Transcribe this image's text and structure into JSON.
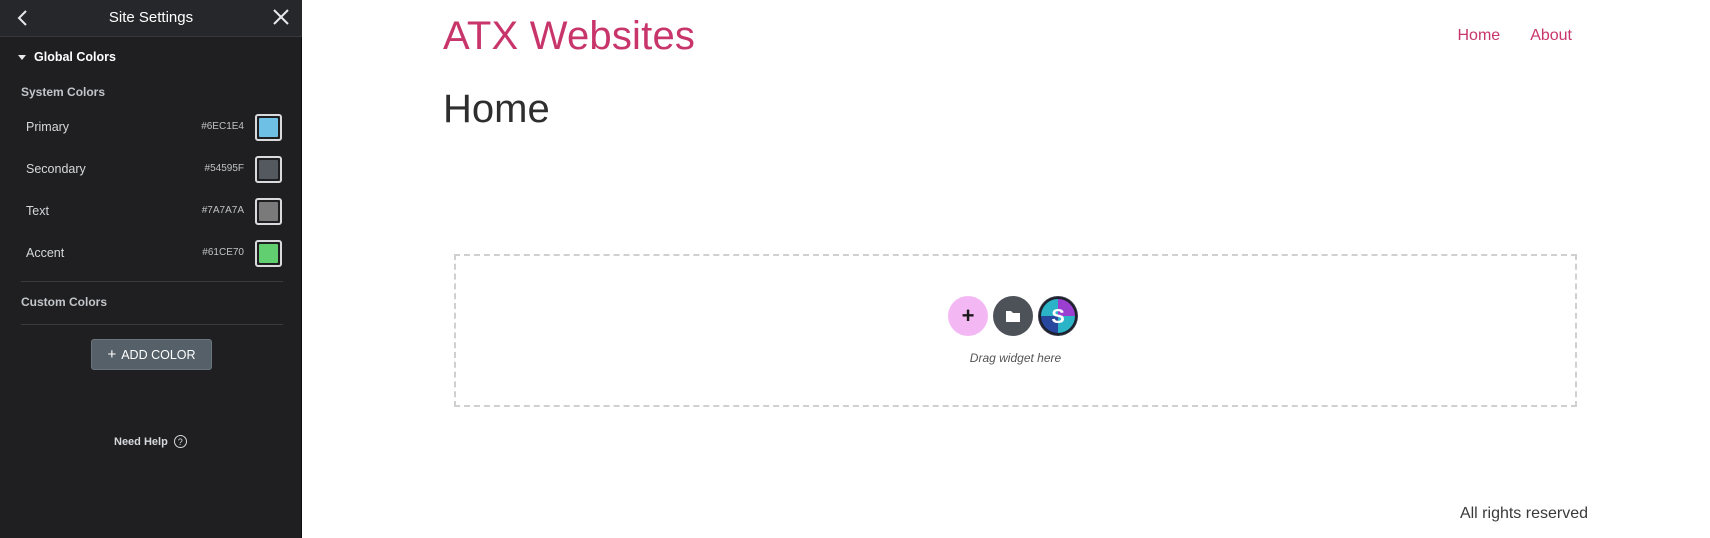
{
  "sidebar": {
    "title": "Site Settings",
    "back_icon": "chevron-left-icon",
    "close_icon": "close-icon",
    "section_title": "Global Colors",
    "system_colors_label": "System Colors",
    "system_colors": [
      {
        "name": "Primary",
        "hex": "#6EC1E4",
        "color": "#6EC1E4"
      },
      {
        "name": "Secondary",
        "hex": "#54595F",
        "color": "#54595F"
      },
      {
        "name": "Text",
        "hex": "#7A7A7A",
        "color": "#7A7A7A"
      },
      {
        "name": "Accent",
        "hex": "#61CE70",
        "color": "#61CE70"
      }
    ],
    "custom_colors_label": "Custom Colors",
    "add_color_label": "ADD COLOR",
    "need_help_label": "Need Help"
  },
  "page": {
    "site_title": "ATX Websites",
    "nav": [
      "Home",
      "About"
    ],
    "heading": "Home",
    "drop_zone_text": "Drag widget here",
    "footer": "All rights reserved"
  },
  "colors": {
    "brand_pink": "#c8356b",
    "sidebar_bg": "#1f1f21",
    "add_widget_bg": "#f3b8f4"
  }
}
